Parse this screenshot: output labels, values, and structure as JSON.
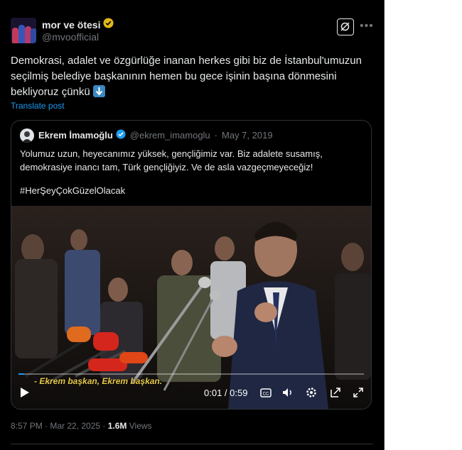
{
  "post": {
    "display_name": "mor ve ötesi",
    "handle": "@mvoofficial",
    "verified_badge": "gold-verified-icon",
    "grok_icon": "grok-icon",
    "more_icon": "more-icon",
    "text": "Demokrasi, adalet ve özgürlüğe inanan herkes gibi biz de İstanbul'umuzun seçilmiş belediye başkanının hemen bu gece işinin başına dönmesini bekliyoruz çünkü",
    "emoji": "down-arrow-emoji",
    "translate_label": "Translate post",
    "time": "8:57 PM · Mar 22, 2025 · ",
    "views_count": "1.6M",
    "views_label": " Views"
  },
  "quote": {
    "display_name": "Ekrem İmamoğlu",
    "verified_badge": "blue-verified-icon",
    "handle": "@ekrem_imamoglu",
    "date": "May 7, 2019",
    "text": "Yolumuz uzun, heyecanımız yüksek, gençliğimiz var. Biz adalete susamış, demokrasiye inancı tam, Türk gençliğiyiz. Ve de asla vazgeçmeyeceğiz!",
    "hashtag": "#HerŞeyÇokGüzelOlacak"
  },
  "video": {
    "caption": "- Ekrem başkan, Ekrem başkan.",
    "time_display": "0:01 / 0:59",
    "progress": 0.017,
    "controls": [
      "play-icon",
      "captions-icon",
      "volume-icon",
      "settings-icon",
      "pop-out-icon",
      "fullscreen-icon"
    ]
  },
  "colors": {
    "accent": "#1d9bf0",
    "background": "#000000",
    "text": "#e7e9ea",
    "secondary": "#71767b",
    "caption": "#e6c94a"
  }
}
